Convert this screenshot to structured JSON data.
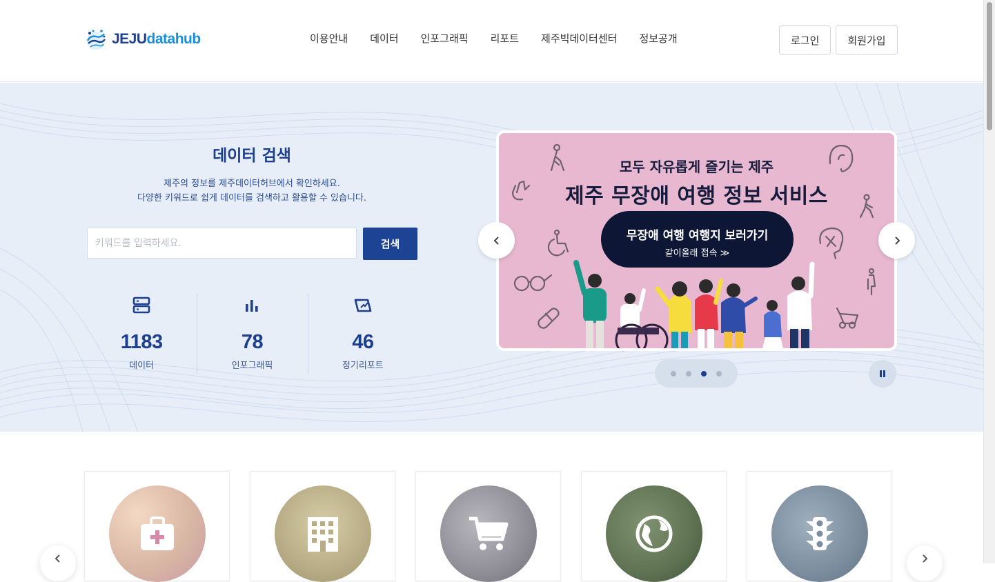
{
  "header": {
    "logo": {
      "jeju": "JEJU",
      "datahub": "datahub"
    },
    "nav": [
      {
        "label": "이용안내"
      },
      {
        "label": "데이터"
      },
      {
        "label": "인포그래픽"
      },
      {
        "label": "리포트"
      },
      {
        "label": "제주빅데이터센터"
      },
      {
        "label": "정보공개"
      }
    ],
    "login_label": "로그인",
    "signup_label": "회원가입"
  },
  "hero": {
    "title": "데이터 검색",
    "desc_line1": "제주의 정보를 제주데이터허브에서 확인하세요.",
    "desc_line2": "다양한 키워드로 쉽게 데이터를 검색하고 활용할 수 있습니다.",
    "search_placeholder": "키워드를 입력하세요.",
    "search_button": "검색",
    "stats": [
      {
        "icon": "database-icon",
        "value": "1183",
        "label": "데이터"
      },
      {
        "icon": "bar-chart-icon",
        "value": "78",
        "label": "인포그래픽"
      },
      {
        "icon": "report-icon",
        "value": "46",
        "label": "정기리포트"
      }
    ]
  },
  "banner": {
    "subtitle": "모두 자유롭게 즐기는 제주",
    "title": "제주 무장애 여행 정보 서비스",
    "pill_main": "무장애 여행 여행지 보러가기",
    "pill_sub": "같이올래 접속 ≫",
    "slide_count": 4,
    "active_slide": 3
  },
  "categories": [
    {
      "icon": "medical-bag-icon",
      "color": "#d9b7a4"
    },
    {
      "icon": "building-icon",
      "color": "#b8ad86"
    },
    {
      "icon": "cart-icon",
      "color": "#8f8e97"
    },
    {
      "icon": "globe-icon",
      "color": "#5f7252"
    },
    {
      "icon": "traffic-light-icon",
      "color": "#7b8d9e"
    }
  ],
  "colors": {
    "primary": "#1d3f8f",
    "accent": "#1c8fd9",
    "hero_bg": "#e7eef8",
    "banner_bg": "#e7b8d0"
  }
}
